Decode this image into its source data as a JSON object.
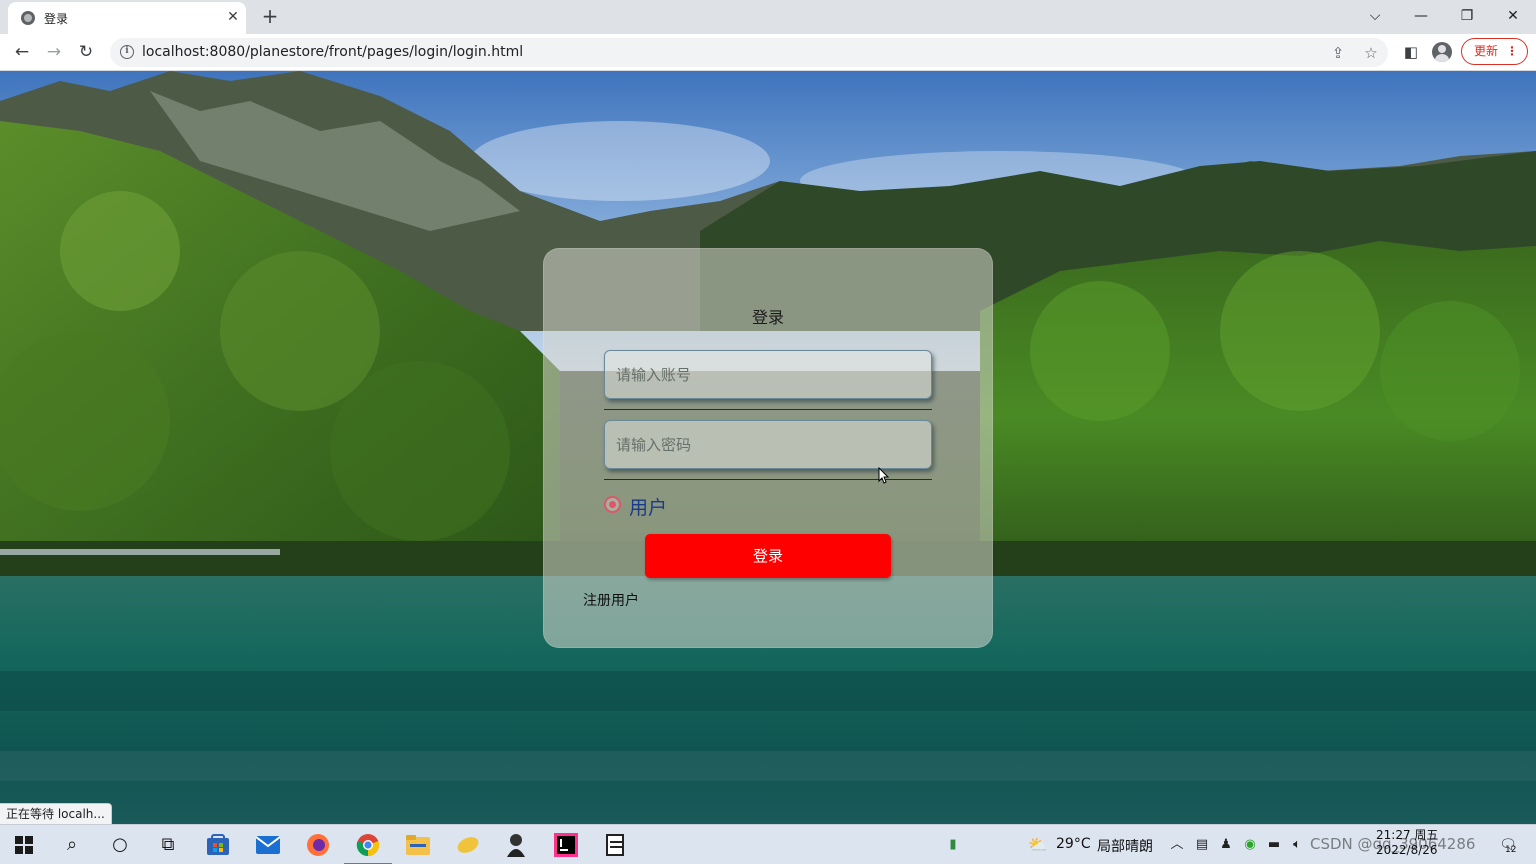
{
  "browser": {
    "tab_title": "登录",
    "tab_close": "✕",
    "new_tab": "+",
    "url": "localhost:8080/planestore/front/pages/login/login.html",
    "update_label": "更新",
    "update_menu": "⋮",
    "status_text": "正在等待 localh..."
  },
  "login": {
    "title": "登录",
    "account_placeholder": "请输入账号",
    "password_placeholder": "请输入密码",
    "role_label": "用户",
    "role_selected": true,
    "submit_label": "登录",
    "register_link": "注册用户"
  },
  "taskbar": {
    "weather_temp": "29°C",
    "weather_desc": "局部晴朗",
    "time": "21:27 周五",
    "date": "2022/8/26",
    "watermark": "CSDN @qq_39064286",
    "notification_count": "12"
  },
  "colors": {
    "login_button": "#ff0000",
    "radio_accent": "#e0556a",
    "role_label": "#1a3a8a",
    "update_accent": "#d93025"
  },
  "icons": {
    "back": "arrow-left-icon",
    "forward": "arrow-right-icon",
    "reload": "reload-icon",
    "site_info": "info-icon",
    "share": "share-icon",
    "bookmark": "star-icon",
    "side_panel": "side-panel-icon",
    "profile": "profile-icon"
  }
}
